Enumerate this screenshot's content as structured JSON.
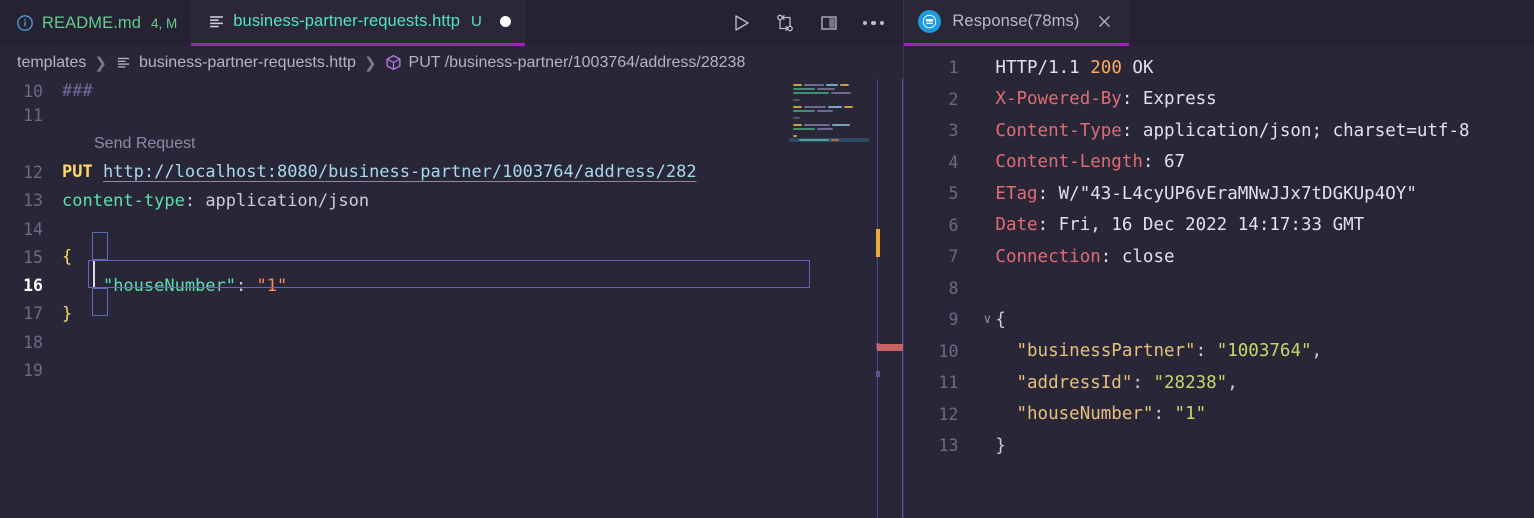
{
  "editor": {
    "tabs": [
      {
        "label": "README.md",
        "badge": "4, M",
        "icon": "info-circle-icon",
        "active": false,
        "dirty": false
      },
      {
        "label": "business-partner-requests.http",
        "badge": "U",
        "icon": "http-file-icon",
        "active": true,
        "dirty": true
      }
    ],
    "actions": [
      {
        "name": "run-request-button",
        "icon": "play-icon"
      },
      {
        "name": "compare-changes-button",
        "icon": "git-compare-icon"
      },
      {
        "name": "split-editor-button",
        "icon": "split-editor-icon"
      },
      {
        "name": "more-actions-button",
        "icon": "ellipsis-icon"
      }
    ],
    "breadcrumb": [
      {
        "label": "templates",
        "icon": ""
      },
      {
        "label": "business-partner-requests.http",
        "icon": "http-file-icon"
      },
      {
        "label": "PUT /business-partner/1003764/address/28238",
        "icon": "symbol-cube-icon"
      }
    ],
    "codelens": "Send Request",
    "lines": [
      {
        "num": "10",
        "text": "###"
      },
      {
        "num": "11",
        "text": ""
      },
      {
        "num": "12",
        "method": "PUT",
        "url": "http://localhost:8080/business-partner/1003764/address/282"
      },
      {
        "num": "13",
        "header": "content-type",
        "value": "application/json"
      },
      {
        "num": "14",
        "text": ""
      },
      {
        "num": "15",
        "text": "{"
      },
      {
        "num": "16",
        "key": "\"houseNumber\"",
        "value": "\"1\""
      },
      {
        "num": "17",
        "text": "}"
      },
      {
        "num": "18",
        "text": ""
      },
      {
        "num": "19",
        "text": ""
      }
    ],
    "colors": {
      "background": "#292637",
      "tabbar": "#262233",
      "active_tab_underline": "#a91ec4",
      "method": "#ffd866",
      "url": "#a7d9ee",
      "header_name": "#5ee0b0",
      "json_key": "#5ee0b0",
      "json_string": "#ff8b5e",
      "line_number": "#6e6985"
    }
  },
  "response": {
    "tab": {
      "label": "Response(78ms)",
      "icon": "rest-client-icon",
      "close_icon": "close-icon"
    },
    "lines": [
      {
        "num": "1",
        "type": "status",
        "proto": "HTTP/1.1",
        "code": "200",
        "text": "OK"
      },
      {
        "num": "2",
        "type": "header",
        "key": "X-Powered-By",
        "value": "Express"
      },
      {
        "num": "3",
        "type": "header",
        "key": "Content-Type",
        "value": "application/json; charset=utf-8"
      },
      {
        "num": "4",
        "type": "header",
        "key": "Content-Length",
        "value": "67"
      },
      {
        "num": "5",
        "type": "header",
        "key": "ETag",
        "value": "W/\"43-L4cyUP6vEraMNwJJx7tDGKUp4OY\""
      },
      {
        "num": "6",
        "type": "header",
        "key": "Date",
        "value": "Fri, 16 Dec 2022 14:17:33 GMT"
      },
      {
        "num": "7",
        "type": "header",
        "key": "Connection",
        "value": "close"
      },
      {
        "num": "8",
        "type": "blank"
      },
      {
        "num": "9",
        "type": "brace",
        "text": "{",
        "fold": "∨"
      },
      {
        "num": "10",
        "type": "json",
        "key": "\"businessPartner\"",
        "value": "\"1003764\"",
        "comma": ","
      },
      {
        "num": "11",
        "type": "json",
        "key": "\"addressId\"",
        "value": "\"28238\"",
        "comma": ","
      },
      {
        "num": "12",
        "type": "json",
        "key": "\"houseNumber\"",
        "value": "\"1\"",
        "comma": ""
      },
      {
        "num": "13",
        "type": "brace",
        "text": "}",
        "fold": ""
      }
    ],
    "colors": {
      "header_name": "#e06c75",
      "status_code": "#ffab5e",
      "json_key": "#e5c07b",
      "json_string": "#c3d96b",
      "badge": "#1c9cd8"
    }
  }
}
